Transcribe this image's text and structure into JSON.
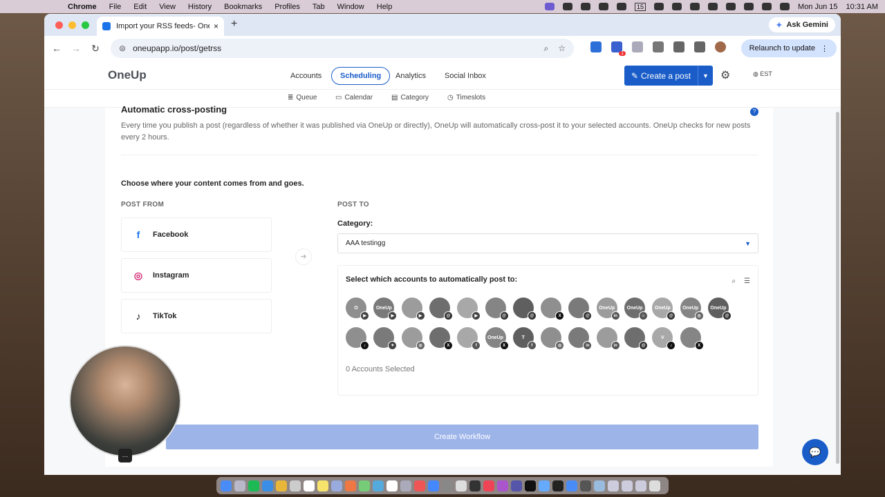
{
  "menubar": {
    "app": "Chrome",
    "items": [
      "File",
      "Edit",
      "View",
      "History",
      "Bookmarks",
      "Profiles",
      "Tab",
      "Window",
      "Help"
    ],
    "date": "Mon Jun 15",
    "time": "10:31 AM",
    "calendar_day": "15"
  },
  "browser": {
    "tab_title": "Import your RSS feeds- OneUp",
    "tab_close": "×",
    "new_tab": "+",
    "ask_gemini": "Ask Gemini",
    "url": "oneupapp.io/post/getrss",
    "relaunch": "Relaunch to update",
    "ext_badge": "1"
  },
  "nav": {
    "logo": "OneUp",
    "items": [
      "Accounts",
      "Scheduling",
      "Analytics",
      "Social Inbox"
    ],
    "active": "Scheduling",
    "create_post": "Create a post",
    "timezone": "EST",
    "subnav": [
      "Queue",
      "Calendar",
      "Category",
      "Timeslots"
    ]
  },
  "content": {
    "title": "Automatic cross-posting",
    "help": "?",
    "description": "Every time you publish a post (regardless of whether it was published via OneUp or directly), OneUp will automatically cross-post it to your selected accounts. OneUp checks for new posts every 2 hours.",
    "choose": "Choose where your content comes from and goes.",
    "post_from_label": "POST FROM",
    "post_to_label": "POST TO",
    "sources": [
      {
        "name": "Facebook",
        "icon": "facebook-icon",
        "glyph": "f",
        "color": "#1877f2"
      },
      {
        "name": "Instagram",
        "icon": "instagram-icon",
        "glyph": "◎",
        "color": "#d62976"
      },
      {
        "name": "TikTok",
        "icon": "tiktok-icon",
        "glyph": "♪",
        "color": "#111111"
      }
    ],
    "category_label": "Category:",
    "category_value": "AAA testingg",
    "accounts_title": "Select which accounts to automatically post to:",
    "accounts_selected": "0 Accounts Selected",
    "create_workflow": "Create Workflow"
  },
  "accounts_row1": [
    {
      "label": "O",
      "badge": "yt"
    },
    {
      "label": "OneUp",
      "badge": "yt"
    },
    {
      "label": "",
      "badge": "yt"
    },
    {
      "label": "",
      "badge": "th"
    },
    {
      "label": "",
      "badge": "yt"
    },
    {
      "label": "",
      "badge": "th"
    },
    {
      "label": "",
      "badge": "th"
    },
    {
      "label": "",
      "badge": "x"
    },
    {
      "label": "",
      "badge": "th"
    },
    {
      "label": "OneUp",
      "badge": "in"
    },
    {
      "label": "OneUp",
      "badge": "sc"
    },
    {
      "label": "OneUp",
      "badge": "th"
    },
    {
      "label": "OneUp",
      "badge": "ig"
    },
    {
      "label": "OneUp",
      "badge": "th"
    }
  ],
  "accounts_row2": [
    {
      "label": "",
      "badge": "tt"
    },
    {
      "label": "",
      "badge": "bs"
    },
    {
      "label": "",
      "badge": "ig"
    },
    {
      "label": "",
      "badge": "x"
    },
    {
      "label": "",
      "badge": "fb"
    },
    {
      "label": "OneUp",
      "badge": "x"
    },
    {
      "label": "T",
      "badge": "fb"
    },
    {
      "label": "",
      "badge": "ig"
    },
    {
      "label": "",
      "badge": "in"
    },
    {
      "label": "",
      "badge": "in"
    },
    {
      "label": "",
      "badge": "th"
    },
    {
      "label": "V",
      "badge": "tt"
    },
    {
      "label": "",
      "badge": "x"
    }
  ],
  "chat_icon": "💬",
  "more": "…"
}
